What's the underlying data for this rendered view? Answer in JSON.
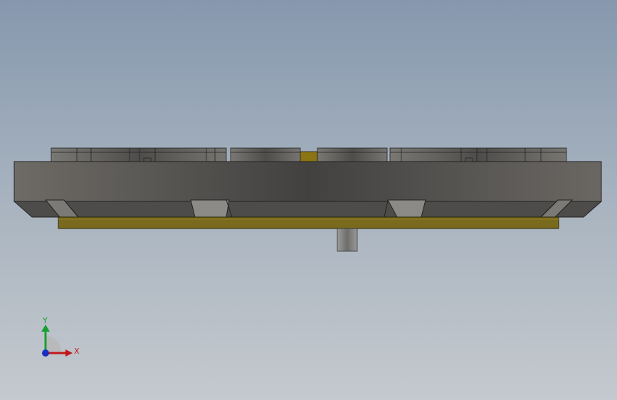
{
  "viewport": {
    "background_top": "#8698ae",
    "background_bottom": "#c4c9ce"
  },
  "model": {
    "body_color": "#555555",
    "plate_color": "#7a6a1e",
    "post_color": "#8a8a8a"
  },
  "triad": {
    "x_label": "X",
    "y_label": "Y",
    "x_color": "#c01818",
    "y_color": "#18a030",
    "z_color": "#1830c0"
  }
}
